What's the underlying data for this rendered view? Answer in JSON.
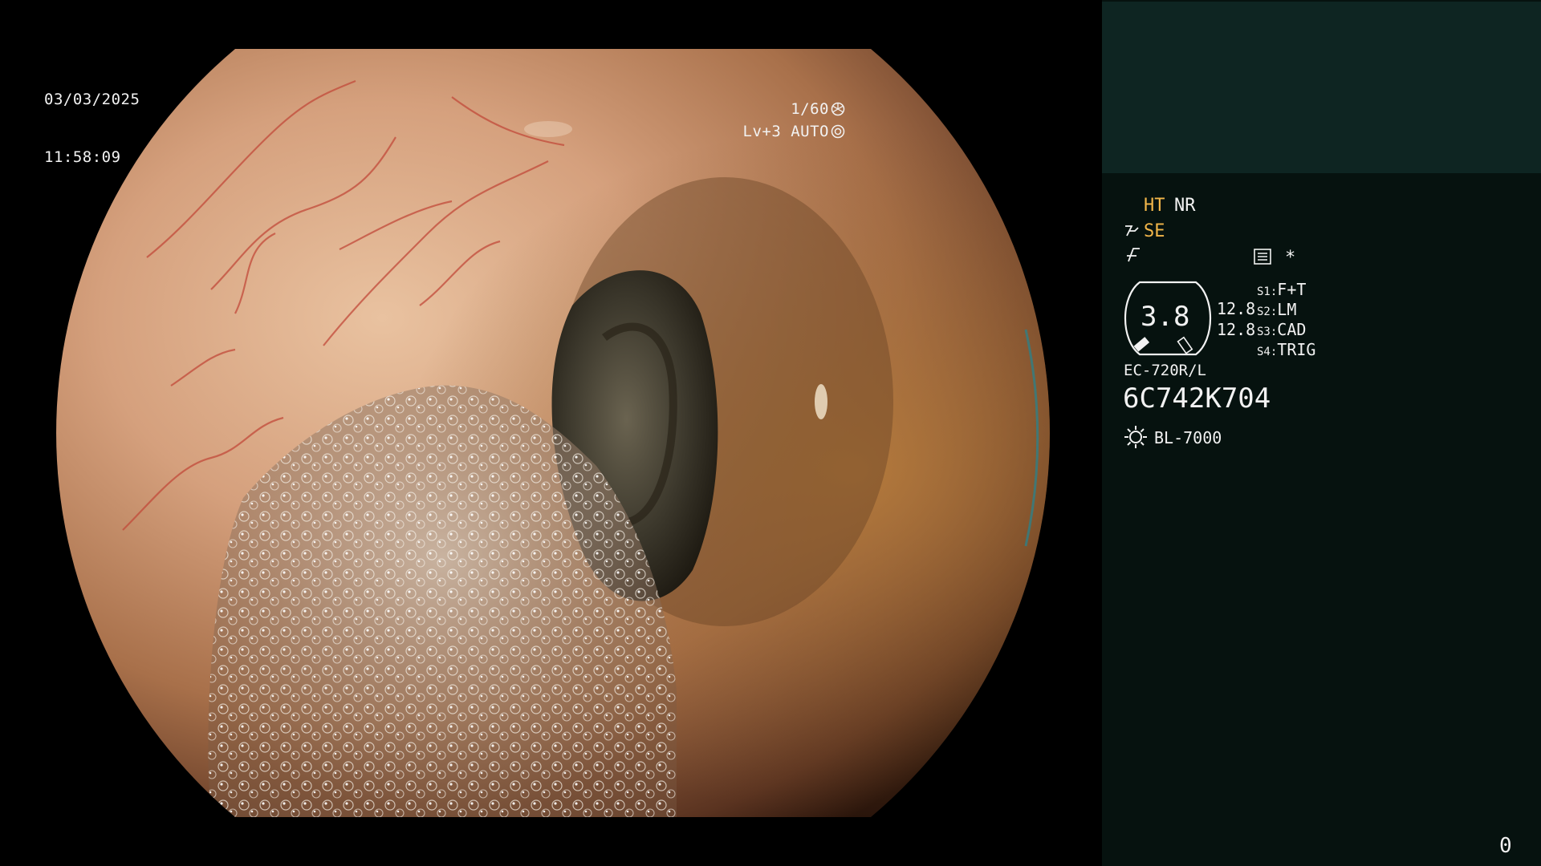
{
  "overlay": {
    "date": "03/03/2025",
    "time": "11:58:09",
    "shutter": "1/60",
    "level": "Lv+3 AUTO"
  },
  "panel": {
    "ht": "HT",
    "nr": "NR",
    "se": "SE",
    "star": "*",
    "gauge_value": "3.8",
    "value_top": "12.8",
    "value_bottom": "12.8",
    "switches": [
      {
        "key": "S1",
        "sep": ":",
        "value": "F+T"
      },
      {
        "key": "S2",
        "sep": ":",
        "value": "LM"
      },
      {
        "key": "S3",
        "sep": ":",
        "value": "CAD"
      },
      {
        "key": "S4",
        "sep": ":",
        "value": "TRIG"
      }
    ],
    "scope_model": "EC-720R/L",
    "scope_serial": "6C742K704",
    "light_source": "BL-7000",
    "counter": "0"
  },
  "icons": [
    "aperture-icon",
    "iris-icon",
    "structure-enhance-icon",
    "filter-icon",
    "record-icon",
    "light-source-icon"
  ],
  "colors": {
    "accent": "#f2b64a",
    "panel_bg": "#06120f",
    "thumb_bg": "#0e2522",
    "text": "#f2f2f2"
  }
}
